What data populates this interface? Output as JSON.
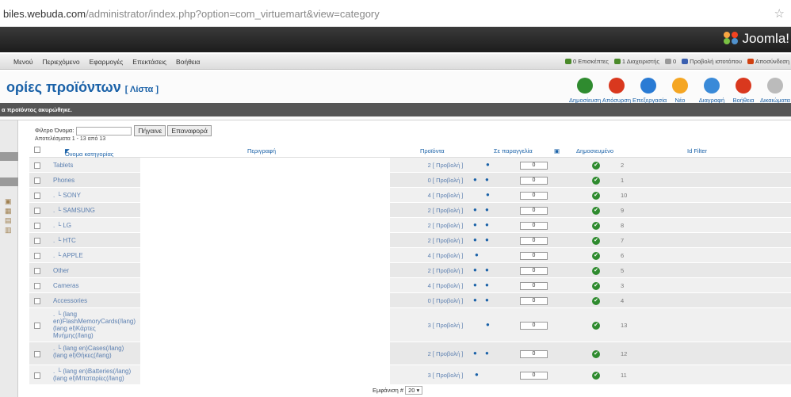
{
  "browser": {
    "url_host": "biles.webuda.com",
    "url_rest": "/administrator/index.php?option=com_virtuemart&view=category"
  },
  "brand": {
    "name": "Joomla!"
  },
  "menu": [
    "Μενού",
    "Περιεχόμενο",
    "Εφαρμογές",
    "Επεκτάσεις",
    "Βοήθεια"
  ],
  "status": [
    {
      "text": "0 Επισκέπτες",
      "color": "#4a8a2a"
    },
    {
      "text": "1 Διαχειριστής",
      "color": "#4a8a2a"
    },
    {
      "text": "0",
      "color": "#999999"
    },
    {
      "text": "Προβολή ιστοτόπου",
      "color": "#3a5fb0"
    },
    {
      "text": "Αποσύνδεση",
      "color": "#d04010"
    }
  ],
  "page": {
    "title": "ορίες προϊόντων",
    "subtitle": "[ Λίστα ]"
  },
  "toolbar": [
    {
      "label": "Δημοσίευση",
      "icon": "publish-icon",
      "color": "#2f8b2f"
    },
    {
      "label": "Απόσυρση",
      "icon": "unpublish-icon",
      "color": "#d9381e"
    },
    {
      "label": "Επεξεργασία",
      "icon": "edit-icon",
      "color": "#2a7bd4"
    },
    {
      "label": "Νέο",
      "icon": "new-icon",
      "color": "#f5a623"
    },
    {
      "label": "Διαγραφή",
      "icon": "delete-icon",
      "color": "#3a8ad8"
    },
    {
      "label": "Βοήθεια",
      "icon": "help-icon",
      "color": "#d9381e"
    },
    {
      "label": "Δικαιώματα",
      "icon": "permissions-icon",
      "color": "#bbbbbb"
    }
  ],
  "message": "α προϊόντος ακυρώθηκε.",
  "filter": {
    "label": "Φίλτρο Όνομα:",
    "go": "Πήγαινε",
    "reset": "Επαναφορά"
  },
  "results": "Αποτελέσματα 1 - 13 από 13",
  "columns": {
    "name": "Όνομα κατηγορίας",
    "desc": "Περιγραφή",
    "products": "Προϊόντα",
    "order": "Σε παραγγελία",
    "published": "Δημοσιευμένο",
    "filter": "Id Filter"
  },
  "rows": [
    {
      "name": "Tablets",
      "products": "2 [ Προβολή ]",
      "arrows": "down",
      "order": "0",
      "id": "2"
    },
    {
      "name": "Phones",
      "products": "0 [ Προβολή ]",
      "arrows": "both",
      "order": "0",
      "id": "1"
    },
    {
      "name": ". └ SONY",
      "products": "4 [ Προβολή ]",
      "arrows": "down",
      "order": "0",
      "id": "10"
    },
    {
      "name": ". └ SAMSUNG",
      "products": "2 [ Προβολή ]",
      "arrows": "both",
      "order": "0",
      "id": "9"
    },
    {
      "name": ". └ LG",
      "products": "2 [ Προβολή ]",
      "arrows": "both",
      "order": "0",
      "id": "8"
    },
    {
      "name": ". └ HTC",
      "products": "2 [ Προβολή ]",
      "arrows": "both",
      "order": "0",
      "id": "7"
    },
    {
      "name": ". └ APPLE",
      "products": "4 [ Προβολή ]",
      "arrows": "up",
      "order": "0",
      "id": "6"
    },
    {
      "name": "Other",
      "products": "2 [ Προβολή ]",
      "arrows": "both",
      "order": "0",
      "id": "5"
    },
    {
      "name": "Cameras",
      "products": "4 [ Προβολή ]",
      "arrows": "both",
      "order": "0",
      "id": "3"
    },
    {
      "name": "Accessories",
      "products": "0 [ Προβολή ]",
      "arrows": "both",
      "order": "0",
      "id": "4"
    },
    {
      "name": ". └ (lang en)FlashMemoryCards(/lang) (lang el)Κάρτες Μνήμης(/lang)",
      "products": "3 [ Προβολή ]",
      "arrows": "down",
      "order": "0",
      "id": "13"
    },
    {
      "name": ". └ (lang en)Cases(/lang) (lang el)Θήκες(/lang)",
      "products": "2 [ Προβολή ]",
      "arrows": "both",
      "order": "0",
      "id": "12"
    },
    {
      "name": ". └ (lang en)Batteries(/lang) (lang el)Μπαταρίες(/lang)",
      "products": "3 [ Προβολή ]",
      "arrows": "up",
      "order": "0",
      "id": "11"
    }
  ],
  "footer": {
    "label": "Εμφάνιση #",
    "value": "20"
  }
}
